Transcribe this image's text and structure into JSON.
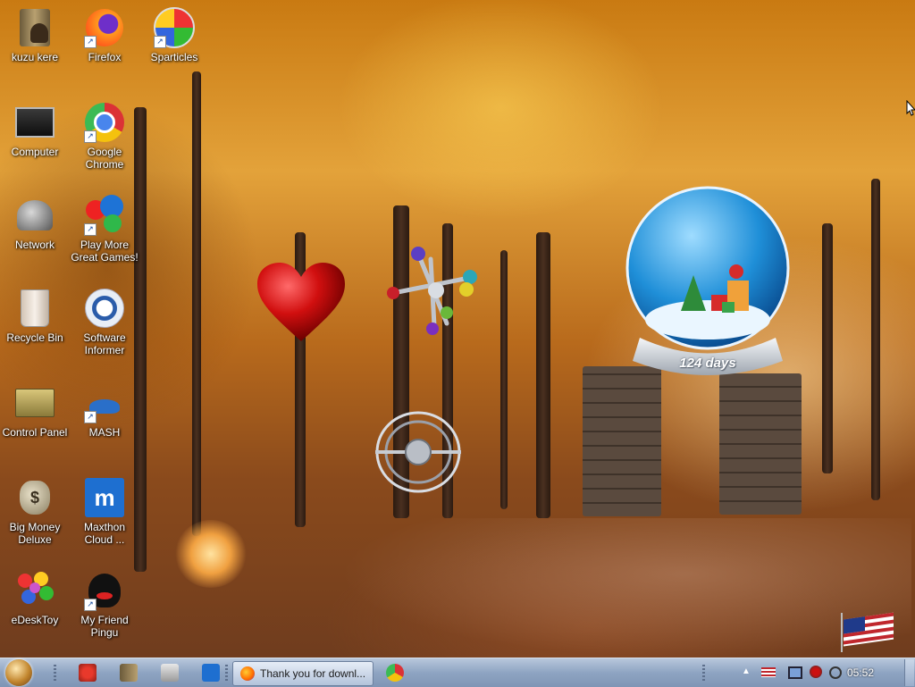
{
  "desktop": {
    "icons": [
      {
        "label": "kuzu kere",
        "icon": "user-folder-icon"
      },
      {
        "label": "Firefox",
        "icon": "firefox-icon"
      },
      {
        "label": "Sparticles",
        "icon": "sparticles-icon"
      },
      {
        "label": "Computer",
        "icon": "computer-icon"
      },
      {
        "label": "Google Chrome",
        "icon": "chrome-icon"
      },
      {
        "label": "Network",
        "icon": "network-icon"
      },
      {
        "label": "Play More Great Games!",
        "icon": "games-icon"
      },
      {
        "label": "Recycle Bin",
        "icon": "recycle-bin-icon"
      },
      {
        "label": "Software Informer",
        "icon": "software-informer-icon"
      },
      {
        "label": "Control Panel",
        "icon": "control-panel-icon"
      },
      {
        "label": "MASH",
        "icon": "mash-icon"
      },
      {
        "label": "Big Money Deluxe",
        "icon": "money-bag-icon"
      },
      {
        "label": "Maxthon Cloud ...",
        "icon": "maxthon-icon"
      },
      {
        "label": "eDeskToy",
        "icon": "edesktoy-icon"
      },
      {
        "label": "My Friend Pingu",
        "icon": "pingu-icon"
      }
    ]
  },
  "widgets": {
    "snow_globe_countdown": "124 days"
  },
  "taskbar": {
    "active_window_title": "Thank you for downl...",
    "clock": "05:52",
    "colors": {
      "bar_top": "#b8c7dc",
      "bar_bottom": "#7f95b5"
    }
  }
}
